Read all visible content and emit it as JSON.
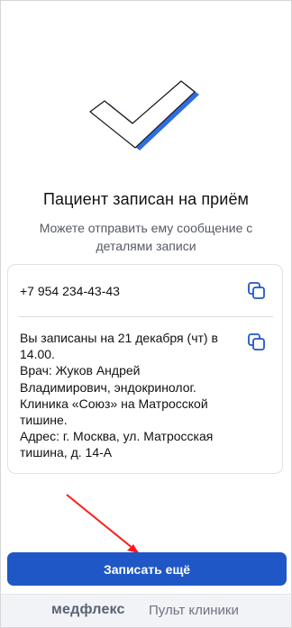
{
  "confirmation": {
    "title": "Пациент записан на приём",
    "subtitle": "Можете отправить ему сообщение с деталями записи"
  },
  "appointment_card": {
    "phone": "+7 954 234-43-43",
    "details": "Вы записаны на 21 декабря (чт) в\n14.00.\nВрач: Жуков Андрей\nВладимирович, эндокринолог.\nКлиника «Союз» на Матросской\nтишине.\nАдрес: г. Москва, ул. Матросская\nтишина, д. 14-А"
  },
  "actions": {
    "book_again": "Записать ещё"
  },
  "footer": {
    "brand": "медфлекс",
    "panel": "Пульт клиники"
  },
  "colors": {
    "primary": "#1f57c7",
    "check_shadow": "#2f6de1",
    "annotation_arrow": "#ff1a1a",
    "footer_background": "#f2f3f6"
  },
  "icons": {
    "success": "check-mark-icon",
    "copy": "copy-icon"
  }
}
